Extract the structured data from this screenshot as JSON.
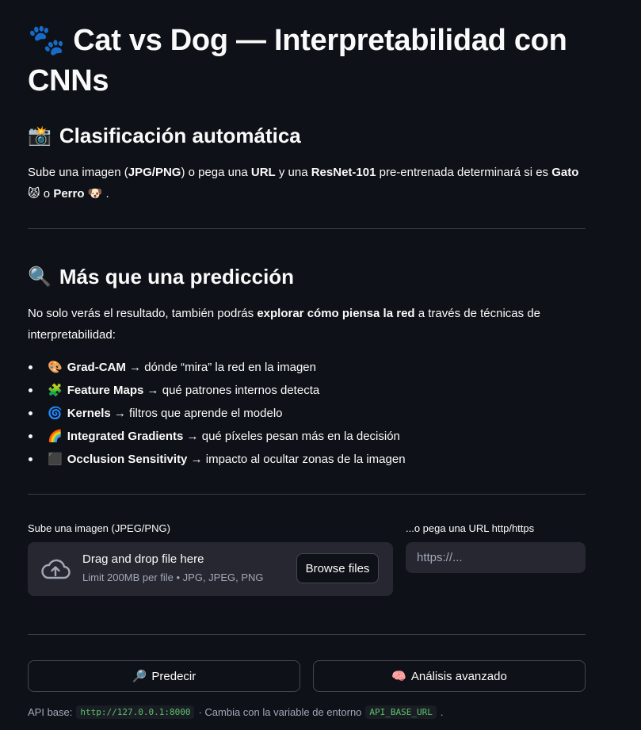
{
  "header": {
    "title_emoji": "🐾",
    "title": "Cat vs Dog — Interpretabilidad con CNNs"
  },
  "section1": {
    "emoji": "📸",
    "heading": "Clasificación automática",
    "p_1": "Sube una imagen (",
    "p_b1": "JPG/PNG",
    "p_2": ") o pega una ",
    "p_b2": "URL",
    "p_3": " y una ",
    "p_b3": "ResNet-101",
    "p_4": " pre-entrenada determinará si es ",
    "p_b4": "Gato",
    "p_e1": "😾",
    "p_5": " o ",
    "p_b5": "Perro",
    "p_e2": "🐶",
    "p_6": " ."
  },
  "section2": {
    "emoji": "🔍",
    "heading": "Más que una predicción",
    "p_1": "No solo verás el resultado, también podrás ",
    "p_b1": "explorar cómo piensa la red",
    "p_2": " a través de técnicas de interpretabilidad:",
    "items": [
      {
        "emoji": "🎨",
        "name": "Grad-CAM",
        "desc": " → dónde “mira” la red en la imagen"
      },
      {
        "emoji": "🧩",
        "name": "Feature Maps",
        "desc": " → qué patrones internos detecta"
      },
      {
        "emoji": "🌀",
        "name": "Kernels",
        "desc": " → filtros que aprende el modelo"
      },
      {
        "emoji": "🌈",
        "name": "Integrated Gradients",
        "desc": " → qué píxeles pesan más en la decisión"
      },
      {
        "emoji": "⬛",
        "name": "Occlusion Sensitivity",
        "desc": " → impacto al ocultar zonas de la imagen"
      }
    ]
  },
  "uploader": {
    "label": "Sube una imagen (JPEG/PNG)",
    "drop_title": "Drag and drop file here",
    "drop_sub": "Limit 200MB per file • JPG, JPEG, PNG",
    "browse_label": "Browse files",
    "icon": "cloud-upload-icon"
  },
  "url_input": {
    "label": "...o pega una URL http/https",
    "placeholder": "https://...",
    "value": ""
  },
  "actions": {
    "predict_emoji": "🔎",
    "predict_label": "Predecir",
    "advanced_emoji": "🧠",
    "advanced_label": "Análisis avanzado"
  },
  "footer": {
    "api_label": "API base:",
    "api_url": "http://127.0.0.1:8000",
    "note": "· Cambia con la variable de entorno",
    "env_var": "API_BASE_URL",
    "end": "."
  },
  "colors": {
    "background": "#0e1117",
    "surface": "#262730",
    "border": "#45474f",
    "muted_text": "#a3a8b8",
    "code_text": "#5ac26a"
  }
}
